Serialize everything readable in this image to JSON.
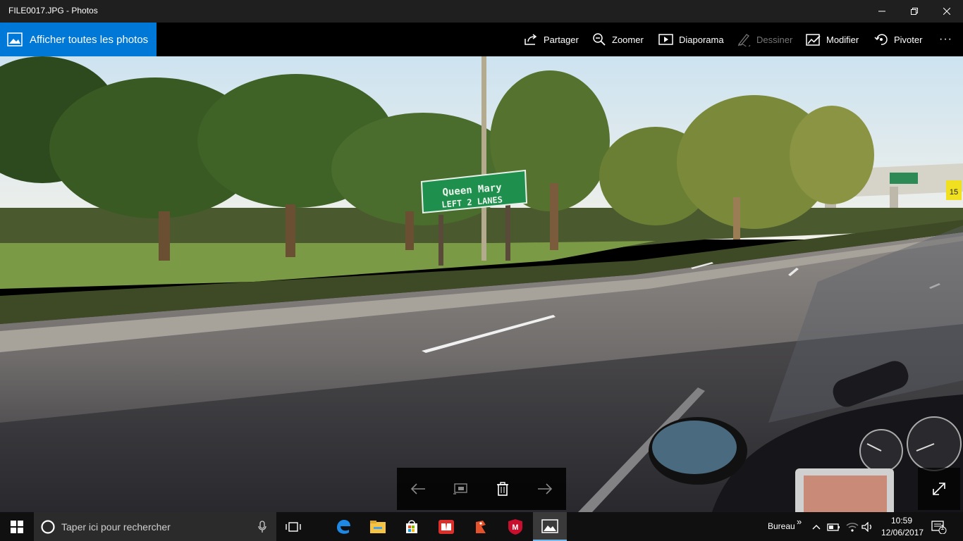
{
  "window": {
    "title": "FILE0017.JPG - Photos",
    "minimize": "—",
    "maximize": "❐",
    "close": "✕"
  },
  "toolbar": {
    "all_photos": "Afficher toutes les photos",
    "share": "Partager",
    "zoom": "Zoomer",
    "slideshow": "Diaporama",
    "draw": "Dessiner",
    "edit": "Modifier",
    "rotate": "Pivoter",
    "more": "···"
  },
  "photo": {
    "sign_line1": "Queen Mary",
    "sign_line2": "LEFT 2 LANES",
    "speed_sign": "15"
  },
  "taskbar": {
    "search_placeholder": "Taper ici pour rechercher",
    "desktop_label": "Bureau",
    "time": "10:59",
    "date": "12/06/2017",
    "notification_count": "1",
    "overflow": "»"
  },
  "icons": {
    "start": "windows-logo-icon",
    "cortana": "cortana-circle-icon",
    "mic": "microphone-icon",
    "taskview": "task-view-icon",
    "edge": "edge-browser-icon",
    "explorer": "file-explorer-icon",
    "store": "store-icon",
    "reader": "reader-icon",
    "app_red": "red-app-icon",
    "mcafee": "mcafee-icon",
    "photos": "photos-app-icon"
  },
  "colors": {
    "accent": "#0078d7",
    "sign_green": "#1f8f4e"
  }
}
